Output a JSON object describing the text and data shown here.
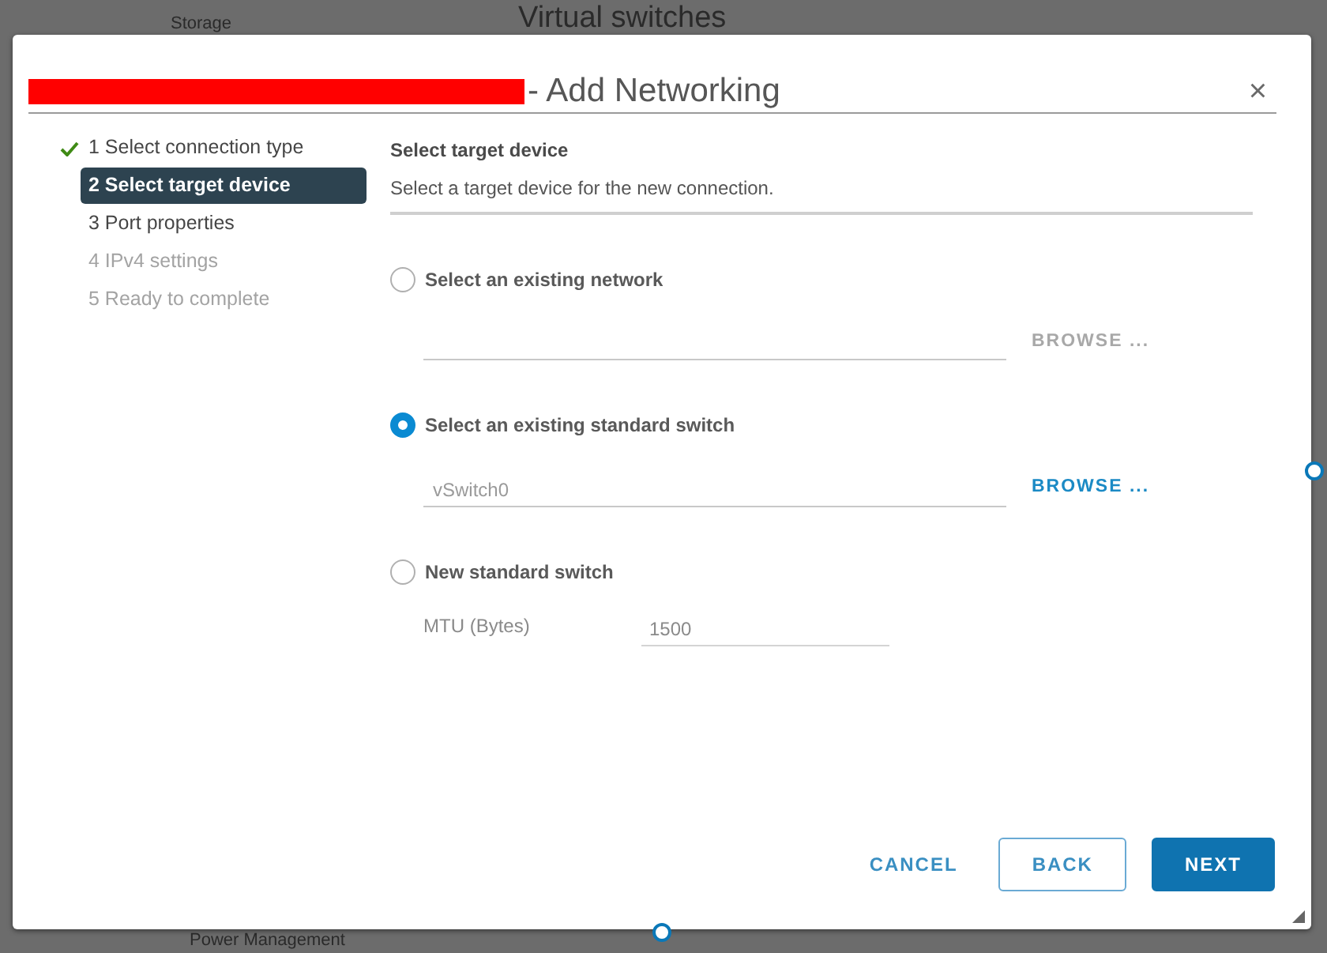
{
  "background_page": {
    "dropdown_label": "Storage",
    "heading": "Virtual switches",
    "list_item": "Power Management"
  },
  "dialog": {
    "title_redacted": true,
    "title": "- Add Networking",
    "close_label": "×",
    "steps": [
      {
        "label": "1 Select connection type",
        "completed": true,
        "selected": false,
        "disabled": false
      },
      {
        "label": "2 Select target device",
        "completed": false,
        "selected": true,
        "disabled": false
      },
      {
        "label": "3 Port properties",
        "completed": false,
        "selected": false,
        "disabled": false
      },
      {
        "label": "4 IPv4 settings",
        "completed": false,
        "selected": false,
        "disabled": true
      },
      {
        "label": "5 Ready to complete",
        "completed": false,
        "selected": false,
        "disabled": true
      }
    ],
    "section": {
      "title": "Select target device",
      "description": "Select a target device for the new connection."
    },
    "options": [
      {
        "kind": "browse",
        "label": "Select an existing network",
        "selected": false,
        "browse_label": "BROWSE ...",
        "browse_disabled": true
      },
      {
        "kind": "browse",
        "label": "Select an existing standard switch",
        "selected": true,
        "value": "vSwitch0",
        "browse_label": "BROWSE ...",
        "browse_disabled": false
      },
      {
        "kind": "mtu",
        "label": "New standard switch",
        "selected": false,
        "field_label": "MTU (Bytes)",
        "value": "1500",
        "disabled": true
      }
    ],
    "buttons": [
      {
        "label": "CANCEL",
        "kind": "link"
      },
      {
        "label": "BACK",
        "kind": "outline"
      },
      {
        "label": "NEXT",
        "kind": "primary"
      }
    ]
  }
}
